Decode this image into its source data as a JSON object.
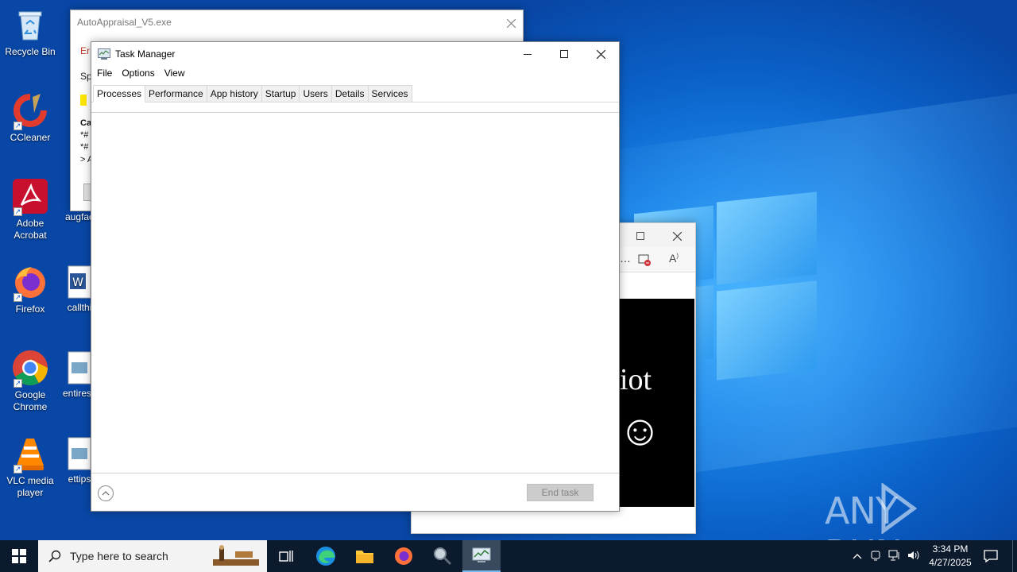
{
  "desktop": {
    "icons": [
      {
        "label": "Recycle Bin"
      },
      {
        "label": "CCleaner"
      },
      {
        "label": "Adobe Acrobat"
      },
      {
        "label": "Firefox"
      },
      {
        "label": "Google Chrome"
      },
      {
        "label": "VLC media player"
      }
    ],
    "icons_col2": [
      {
        "label": "augfac"
      },
      {
        "label": "callthi"
      },
      {
        "label": "entiresc"
      },
      {
        "label": "ettips"
      }
    ],
    "watermark": "ANY RUN"
  },
  "autoappraisal_window": {
    "title": "AutoAppraisal_V5.exe",
    "partial_lines": [
      "Er",
      "Sp",
      "Ca",
      "*#",
      "*#",
      "> A"
    ]
  },
  "browser_fragment": {
    "text": "iot",
    "smiley": "☺"
  },
  "task_manager": {
    "title": "Task Manager",
    "menu": [
      "File",
      "Options",
      "View"
    ],
    "tabs": [
      "Processes",
      "Performance",
      "App history",
      "Startup",
      "Users",
      "Details",
      "Services"
    ],
    "active_tab": "Processes",
    "end_task_label": "End task"
  },
  "taskbar": {
    "search_placeholder": "Type here to search",
    "clock_time": "3:34 PM",
    "clock_date": "4/27/2025"
  },
  "colors": {
    "accent": "#0078d7",
    "taskbar": "#0c1a2e"
  }
}
